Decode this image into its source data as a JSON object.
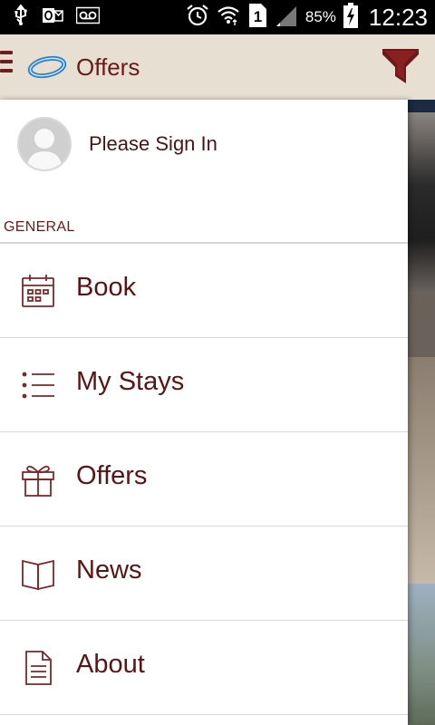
{
  "status_bar": {
    "battery_percent": "85%",
    "time": "12:23",
    "sim_slot": "1",
    "icons": [
      "usb-icon",
      "outlook-icon",
      "voicemail-icon",
      "alarm-icon",
      "wifi-icon",
      "sim-icon",
      "signal-icon",
      "battery-charging-icon"
    ]
  },
  "app_bar": {
    "title": "Offers",
    "icons": [
      "menu-icon",
      "brand-logo",
      "filter-icon"
    ]
  },
  "drawer": {
    "profile": {
      "label": "Please Sign In"
    },
    "section_header": "GENERAL",
    "items": [
      {
        "label": "Book",
        "icon": "calendar-icon"
      },
      {
        "label": "My Stays",
        "icon": "list-icon"
      },
      {
        "label": "Offers",
        "icon": "gift-icon"
      },
      {
        "label": "News",
        "icon": "book-icon"
      },
      {
        "label": "About",
        "icon": "document-icon"
      }
    ]
  },
  "colors": {
    "accent": "#6b1a1a",
    "appbar_bg": "#e8dfd3",
    "status_bar_bg": "#000000"
  }
}
